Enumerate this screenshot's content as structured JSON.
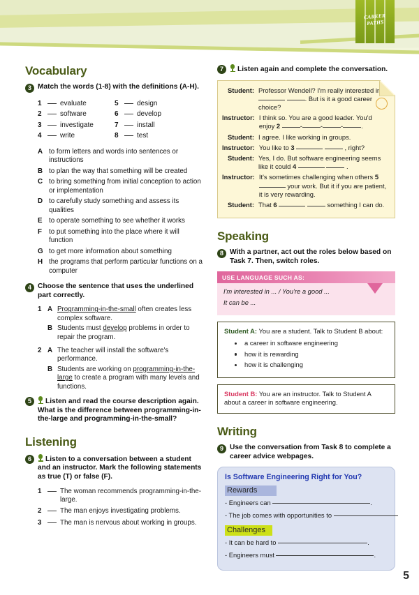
{
  "logo": {
    "line1": "Career",
    "line2": "Paths"
  },
  "page_number": "5",
  "left": {
    "vocabulary_heading": "Vocabulary",
    "task3": {
      "num": "3",
      "text": "Match the words (1-8) with the definitions (A-H)."
    },
    "words_col1": [
      {
        "n": "1",
        "w": "evaluate"
      },
      {
        "n": "2",
        "w": "software"
      },
      {
        "n": "3",
        "w": "investigate"
      },
      {
        "n": "4",
        "w": "write"
      }
    ],
    "words_col2": [
      {
        "n": "5",
        "w": "design"
      },
      {
        "n": "6",
        "w": "develop"
      },
      {
        "n": "7",
        "w": "install"
      },
      {
        "n": "8",
        "w": "test"
      }
    ],
    "definitions": [
      {
        "l": "A",
        "t": "to form letters and words into sentences or instructions"
      },
      {
        "l": "B",
        "t": "to plan the way that something will be created"
      },
      {
        "l": "C",
        "t": "to bring something from initial conception to action or implementation"
      },
      {
        "l": "D",
        "t": "to carefully study something and assess its qualities"
      },
      {
        "l": "E",
        "t": "to operate something to see whether it works"
      },
      {
        "l": "F",
        "t": "to put something into the place where it will function"
      },
      {
        "l": "G",
        "t": "to get more information about something"
      },
      {
        "l": "H",
        "t": "the programs that perform particular functions on a computer"
      }
    ],
    "task4": {
      "num": "4",
      "text": "Choose the sentence that uses the underlined part correctly."
    },
    "choices": [
      {
        "num": "1",
        "options": [
          {
            "ltr": "A",
            "pre": "",
            "underline": "Programming-in-the-small",
            "post": " often creates less complex software."
          },
          {
            "ltr": "B",
            "pre": "Students must ",
            "underline": "develop",
            "post": " problems in order to repair the program."
          }
        ]
      },
      {
        "num": "2",
        "options": [
          {
            "ltr": "A",
            "pre": "The teacher will install the software's performance.",
            "underline": "",
            "post": ""
          },
          {
            "ltr": "B",
            "pre": "Students are working on ",
            "underline": "programming-in-the-large",
            "post": " to create a program with many levels and functions."
          }
        ]
      }
    ],
    "task5": {
      "num": "5",
      "text": "Listen and read the course description again. What is the difference between programming-in-the-large and programming-in-the-small?"
    },
    "listening_heading": "Listening",
    "task6": {
      "num": "6",
      "text": "Listen to a conversation between a student and an instructor. Mark the following statements as true (T) or false (F)."
    },
    "tf_statements": [
      {
        "n": "1",
        "t": "The woman recommends programming-in-the-large."
      },
      {
        "n": "2",
        "t": "The man enjoys investigating problems."
      },
      {
        "n": "3",
        "t": "The man is nervous about working in groups."
      }
    ]
  },
  "right": {
    "task7": {
      "num": "7",
      "text": "Listen again and complete the conversation."
    },
    "dialogue": [
      {
        "speaker": "Student:",
        "parts": [
          "Professor Wendell? I'm really interested in ",
          "1",
          " ____ ____",
          ". But is it a good career choice?"
        ]
      },
      {
        "speaker": "Instructor:",
        "parts": [
          "I think so. You are a good leader. You'd enjoy ",
          "2",
          " ____-____-____-____",
          "."
        ]
      },
      {
        "speaker": "Student:",
        "parts": [
          "I agree. I like working in groups.",
          "",
          "",
          ""
        ]
      },
      {
        "speaker": "Instructor:",
        "parts": [
          "You like to ",
          "3",
          " ____ ____",
          " , right?"
        ]
      },
      {
        "speaker": "Student:",
        "parts": [
          "Yes, I do. But software engineering seems like it could ",
          "4",
          " ____ ____",
          " ."
        ]
      },
      {
        "speaker": "Instructor:",
        "parts": [
          "It's sometimes challenging when others ",
          "5",
          " ____",
          " your work. But it if you are patient, it is very rewarding."
        ]
      },
      {
        "speaker": "Student:",
        "parts": [
          "That ",
          "6",
          " ____ ____",
          " something I can do."
        ]
      }
    ],
    "speaking_heading": "Speaking",
    "task8": {
      "num": "8",
      "text": "With a partner, act out the roles below based on Task 7. Then, switch roles."
    },
    "lang_box": {
      "title": "USE LANGUAGE SUCH AS:",
      "lines": [
        "I'm interested in ... / You're a good ...",
        "It can be ..."
      ]
    },
    "role_a": {
      "label": "Student A:",
      "intro": " You are a student. Talk to Student B about:",
      "bullets": [
        "a career in software engineering",
        "how it is rewarding",
        "how it is challenging"
      ]
    },
    "role_b": {
      "label": "Student B:",
      "intro": " You are an instructor. Talk to Student A about a career in software engineering."
    },
    "writing_heading": "Writing",
    "task9": {
      "num": "9",
      "text": "Use the conversation from Task 8 to complete a career advice webpages."
    },
    "web_card": {
      "title": "Is Software Engineering Right for You?",
      "rewards_tag": "Rewards",
      "rewards_lines": [
        "- Engineers can ",
        "- The job comes with opportunities to "
      ],
      "challenges_tag": "Challenges",
      "challenges_lines": [
        "- It can be hard to ",
        "- Engineers must "
      ]
    }
  },
  "colors": {
    "heading_green": "#4a5b16",
    "task_badge": "#2e4416",
    "logo_green": "#8aa81f",
    "note_cream": "#fdf7d7",
    "pink_header": "#e0669c",
    "pink_body": "#fbe2ec",
    "web_blue_bg": "#dde3f2",
    "web_title_blue": "#2238b0",
    "rewards_highlight": "#aab6dd",
    "challenges_highlight": "#cde018",
    "student_a_green": "#2f5a22",
    "student_b_red": "#d8365f"
  }
}
